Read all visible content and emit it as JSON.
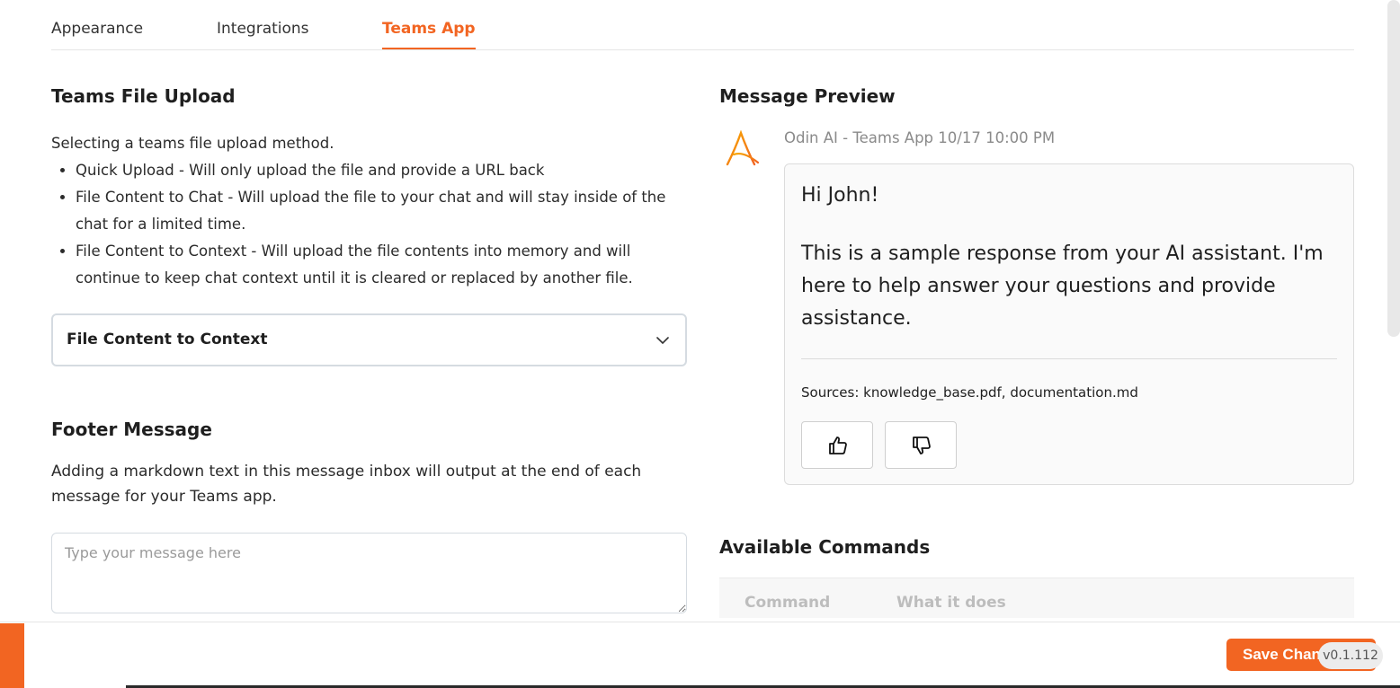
{
  "tabs": [
    {
      "label": "Appearance"
    },
    {
      "label": "Integrations"
    },
    {
      "label": "Teams App"
    }
  ],
  "file_upload": {
    "title": "Teams File Upload",
    "intro": "Selecting a teams file upload method.",
    "options_help": [
      "Quick Upload - Will only upload the file and provide a URL back",
      "File Content to Chat - Will upload the file to your chat and will stay inside of the chat for a limited time.",
      "File Content to Context - Will upload the file contents into memory and will continue to keep chat context until it is cleared or replaced by another file."
    ],
    "selected": "File Content to Context"
  },
  "footer_message": {
    "title": "Footer Message",
    "description": "Adding a markdown text in this message inbox will output at the end of each message for your Teams app.",
    "placeholder": "Type your message here"
  },
  "preview": {
    "title": "Message Preview",
    "sender": "Odin AI - Teams App 10/17 10:00 PM",
    "greeting": "Hi John!",
    "body": "This is a sample response from your AI assistant. I'm here to help answer your questions and provide assistance.",
    "sources": "Sources: knowledge_base.pdf, documentation.md"
  },
  "commands": {
    "title": "Available Commands",
    "headers": [
      "Command",
      "What it does"
    ]
  },
  "footer_bar": {
    "save_label": "Save Changes",
    "version": "v0.1.112"
  },
  "colors": {
    "accent": "#f26522"
  }
}
